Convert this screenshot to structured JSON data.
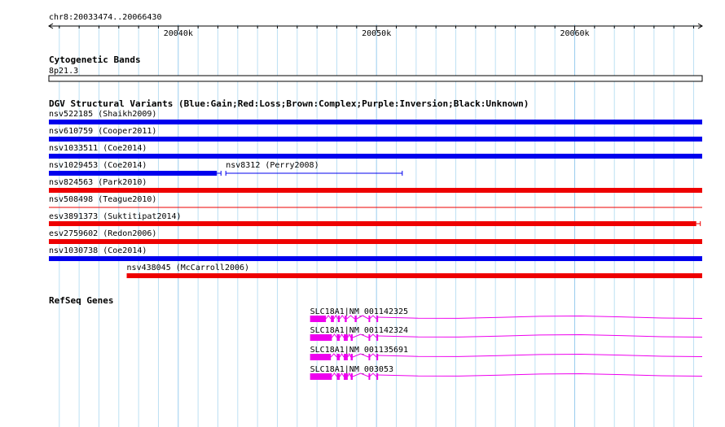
{
  "ruler": {
    "region_label": "chr8:20033474..20066430",
    "start": 20033474,
    "end": 20066430,
    "ticks": [
      {
        "pos": 20040000,
        "label": "20040k"
      },
      {
        "pos": 20050000,
        "label": "20050k"
      },
      {
        "pos": 20060000,
        "label": "20060k"
      }
    ]
  },
  "cytoband": {
    "title": "Cytogenetic Bands",
    "band_label": "8p21.3"
  },
  "dgv": {
    "title": "DGV Structural Variants (Blue:Gain;Red:Loss;Brown:Complex;Purple:Inversion;Black:Unknown)",
    "colors": {
      "gain": "#0000ee",
      "loss": "#ee0000"
    },
    "variants": [
      {
        "id": "nsv522185 (Shaikh2009)",
        "start": 20033474,
        "end": 20066430,
        "type": "gain"
      },
      {
        "id": "nsv610759 (Cooper2011)",
        "start": 20033474,
        "end": 20066430,
        "type": "gain"
      },
      {
        "id": "nsv1033511 (Coe2014)",
        "start": 20033474,
        "end": 20066430,
        "type": "gain"
      },
      {
        "id": "nsv1029453 (Coe2014)",
        "start": 20033474,
        "end": 20041950,
        "type": "gain"
      },
      {
        "id": "nsv8312 (Perry2008)",
        "start": 20042400,
        "end": 20051300,
        "type": "gain",
        "thin": true
      },
      {
        "id": "nsv824563 (Park2010)",
        "start": 20033474,
        "end": 20066430,
        "type": "loss"
      },
      {
        "id": "nsv508498 (Teague2010)",
        "start": 20033474,
        "end": 20066430,
        "type": "loss",
        "line": true
      },
      {
        "id": "esv3891373 (Suktitipat2014)",
        "start": 20033474,
        "end": 20066130,
        "type": "loss"
      },
      {
        "id": "esv2759602 (Redon2006)",
        "start": 20033474,
        "end": 20066430,
        "type": "loss"
      },
      {
        "id": "nsv1030738 (Coe2014)",
        "start": 20033474,
        "end": 20066430,
        "type": "gain"
      },
      {
        "id": "nsv438045 (McCarroll2006)",
        "start": 20037400,
        "end": 20066430,
        "type": "loss"
      }
    ]
  },
  "refseq": {
    "title": "RefSeq Genes",
    "color": "#ee00ee",
    "genes": [
      {
        "name": "SLC18A1|NM_001142325",
        "start": 20046650,
        "end": 20066430,
        "exons": [
          [
            20046650,
            20047450
          ],
          [
            20047700,
            20047850
          ],
          [
            20048050,
            20048150
          ],
          [
            20048400,
            20048500
          ],
          [
            20048900,
            20049000
          ],
          [
            20049600,
            20049650
          ],
          [
            20050000,
            20050050
          ]
        ]
      },
      {
        "name": "SLC18A1|NM_001142324",
        "start": 20046650,
        "end": 20066430,
        "exons": [
          [
            20046650,
            20047750
          ],
          [
            20048000,
            20048150
          ],
          [
            20048350,
            20048550
          ],
          [
            20048700,
            20048800
          ],
          [
            20049600,
            20049650
          ],
          [
            20050000,
            20050050
          ]
        ]
      },
      {
        "name": "SLC18A1|NM_001135691",
        "start": 20046650,
        "end": 20066430,
        "exons": [
          [
            20046650,
            20047700
          ],
          [
            20048000,
            20048150
          ],
          [
            20048350,
            20048550
          ],
          [
            20048700,
            20048800
          ],
          [
            20049600,
            20049650
          ],
          [
            20050000,
            20050050
          ]
        ]
      },
      {
        "name": "SLC18A1|NM_003053",
        "start": 20046650,
        "end": 20066430,
        "exons": [
          [
            20046650,
            20047750
          ],
          [
            20048000,
            20048150
          ],
          [
            20048350,
            20048550
          ],
          [
            20048700,
            20048800
          ],
          [
            20049600,
            20049650
          ],
          [
            20050000,
            20050050
          ]
        ]
      }
    ]
  }
}
